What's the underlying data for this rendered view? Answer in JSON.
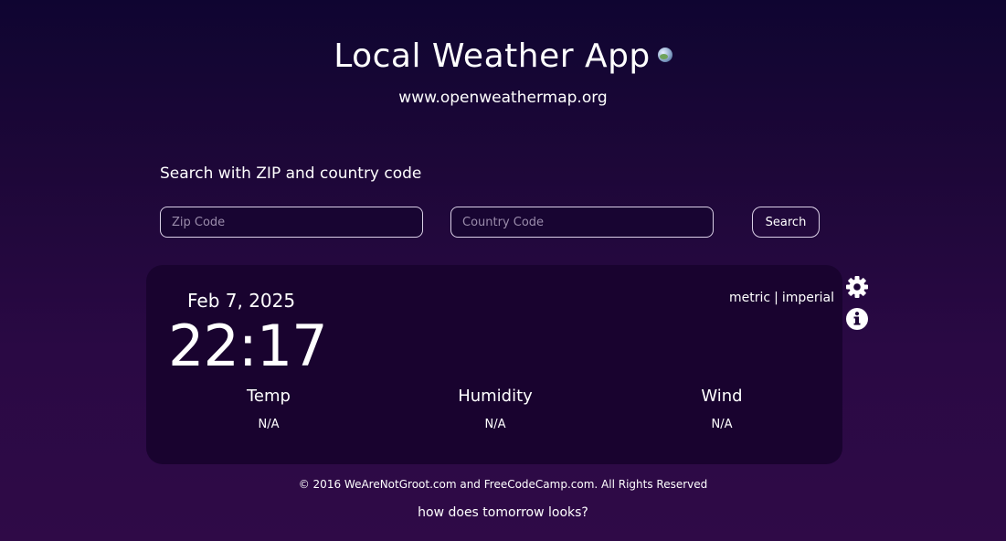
{
  "header": {
    "title": "Local Weather App",
    "subtitle": "www.openweathermap.org"
  },
  "search": {
    "heading": "Search with ZIP and country code",
    "zip_placeholder": "Zip Code",
    "zip_value": "",
    "country_placeholder": "Country Code",
    "country_value": "",
    "button_label": "Search"
  },
  "weather": {
    "date": "Feb 7, 2025",
    "time": "22:17",
    "unit_metric": "metric",
    "unit_separator": "|",
    "unit_imperial": "imperial",
    "stats": [
      {
        "label": "Temp",
        "value": "N/A"
      },
      {
        "label": "Humidity",
        "value": "N/A"
      },
      {
        "label": "Wind",
        "value": "N/A"
      }
    ]
  },
  "icons": {
    "globe": "globe-icon",
    "settings": "gear-icon",
    "info": "info-icon"
  },
  "footer": {
    "copyright": "© 2016 WeAreNotGroot.com and FreeCodeCamp.com. All Rights Reserved",
    "tomorrow_link": "how does tomorrow looks?"
  },
  "colors": {
    "background_top": "#0f0531",
    "background_bottom": "#2f0a47",
    "card": "#19032f",
    "text": "#ffffff"
  }
}
